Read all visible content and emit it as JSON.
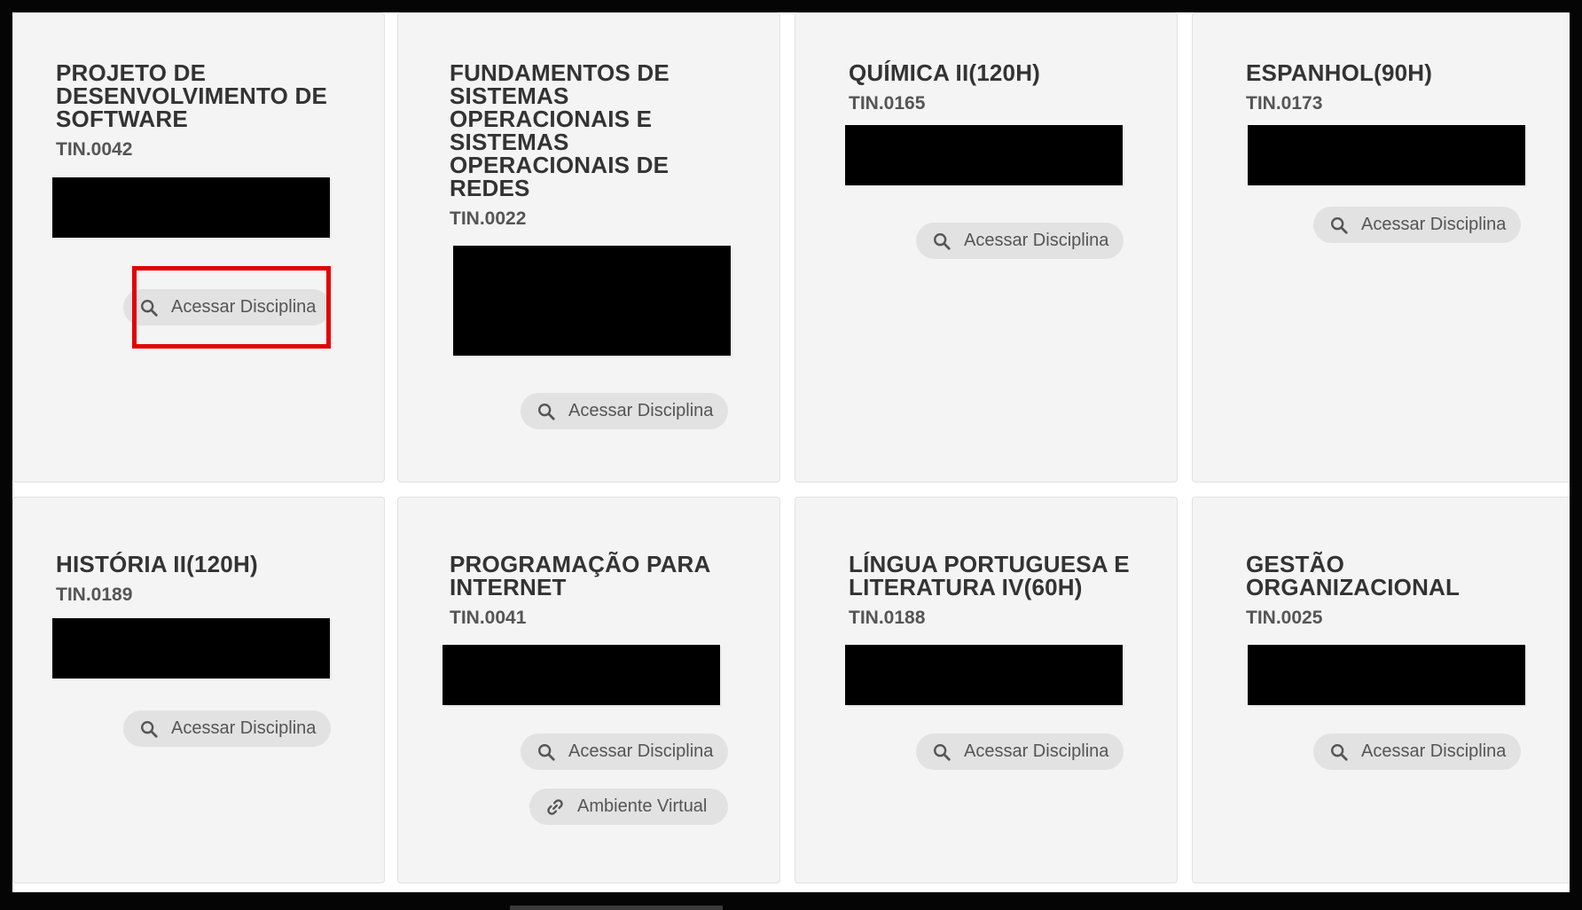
{
  "cards": [
    {
      "title": "PROJETO DE DESENVOLVIMENTO DE SOFTWARE",
      "code": "TIN.0042"
    },
    {
      "title": "FUNDAMENTOS DE SISTEMAS OPERACIONAIS E SISTEMAS OPERACIONAIS DE REDES",
      "code": "TIN.0022"
    },
    {
      "title": "QUÍMICA II(120H)",
      "code": "TIN.0165"
    },
    {
      "title": "ESPANHOL(90H)",
      "code": "TIN.0173"
    },
    {
      "title": "HISTÓRIA II(120H)",
      "code": "TIN.0189"
    },
    {
      "title": "PROGRAMAÇÃO PARA INTERNET",
      "code": "TIN.0041"
    },
    {
      "title": "LÍNGUA PORTUGUESA E LITERATURA IV(60H)",
      "code": "TIN.0188"
    },
    {
      "title": "GESTÃO ORGANIZACIONAL",
      "code": "TIN.0025"
    }
  ],
  "buttons": {
    "access_label": "Acessar Disciplina",
    "virtual_label": "Ambiente Virtual"
  },
  "icons": {
    "access": "search-icon",
    "virtual": "link-icon"
  },
  "colors": {
    "highlight": "#e30000",
    "card_bg": "#f4f4f4",
    "pill_bg": "#e2e2e2"
  }
}
